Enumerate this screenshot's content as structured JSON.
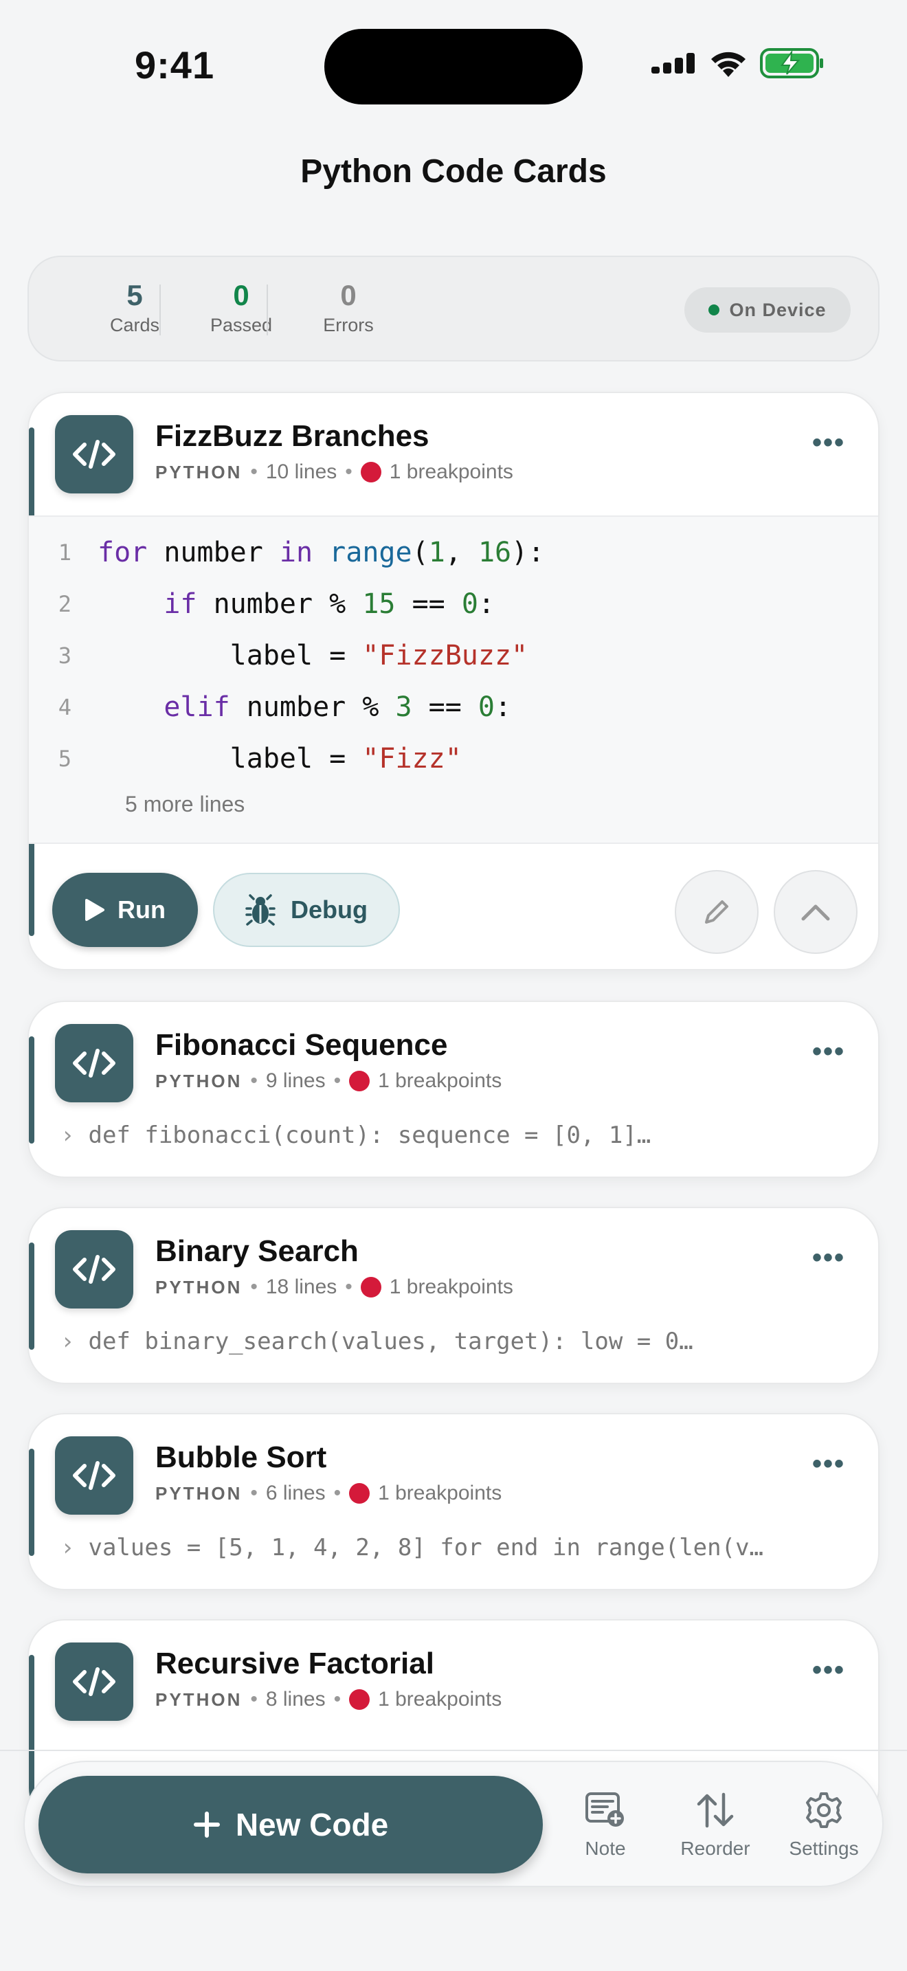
{
  "status_bar": {
    "time": "9:41"
  },
  "header": {
    "title": "Python Code Cards"
  },
  "stats": {
    "cards": {
      "value": "5",
      "label": "Cards"
    },
    "passed": {
      "value": "0",
      "label": "Passed"
    },
    "errors": {
      "value": "0",
      "label": "Errors"
    },
    "badge": "On Device"
  },
  "colors": {
    "accent": "#3e6168",
    "breakpoint": "#d41a3a",
    "passed": "#11854a"
  },
  "expanded_card": {
    "title": "FizzBuzz Branches",
    "lang": "PYTHON",
    "lines": "10 lines",
    "breakpoints": "1 breakpoints",
    "code": [
      {
        "n": "1",
        "tokens": [
          {
            "t": "for",
            "c": "kw"
          },
          {
            "t": " number ",
            "c": ""
          },
          {
            "t": "in",
            "c": "kw"
          },
          {
            "t": " ",
            "c": ""
          },
          {
            "t": "range",
            "c": "fn"
          },
          {
            "t": "(",
            "c": ""
          },
          {
            "t": "1",
            "c": "num"
          },
          {
            "t": ", ",
            "c": ""
          },
          {
            "t": "16",
            "c": "num"
          },
          {
            "t": "):",
            "c": ""
          }
        ]
      },
      {
        "n": "2",
        "tokens": [
          {
            "t": "    ",
            "c": ""
          },
          {
            "t": "if",
            "c": "kw"
          },
          {
            "t": " number % ",
            "c": ""
          },
          {
            "t": "15",
            "c": "num"
          },
          {
            "t": " == ",
            "c": ""
          },
          {
            "t": "0",
            "c": "num"
          },
          {
            "t": ":",
            "c": ""
          }
        ]
      },
      {
        "n": "3",
        "tokens": [
          {
            "t": "        label = ",
            "c": ""
          },
          {
            "t": "\"FizzBuzz\"",
            "c": "str"
          }
        ]
      },
      {
        "n": "4",
        "tokens": [
          {
            "t": "    ",
            "c": ""
          },
          {
            "t": "elif",
            "c": "kw"
          },
          {
            "t": " number % ",
            "c": ""
          },
          {
            "t": "3",
            "c": "num"
          },
          {
            "t": " == ",
            "c": ""
          },
          {
            "t": "0",
            "c": "num"
          },
          {
            "t": ":",
            "c": ""
          }
        ]
      },
      {
        "n": "5",
        "tokens": [
          {
            "t": "        label = ",
            "c": ""
          },
          {
            "t": "\"Fizz\"",
            "c": "str"
          }
        ]
      }
    ],
    "more_lines": "5 more lines",
    "run_label": "Run",
    "debug_label": "Debug"
  },
  "cards": [
    {
      "title": "Fibonacci Sequence",
      "lang": "PYTHON",
      "lines": "9 lines",
      "breakpoints": "1 breakpoints",
      "preview": "def fibonacci(count):     sequence = [0, 1]…"
    },
    {
      "title": "Binary Search",
      "lang": "PYTHON",
      "lines": "18 lines",
      "breakpoints": "1 breakpoints",
      "preview": "def binary_search(values, target):     low = 0…"
    },
    {
      "title": "Bubble Sort",
      "lang": "PYTHON",
      "lines": "6 lines",
      "breakpoints": "1 breakpoints",
      "preview": "values = [5, 1, 4, 2, 8] for end in range(len(v…"
    },
    {
      "title": "Recursive Factorial",
      "lang": "PYTHON",
      "lines": "8 lines",
      "breakpoints": "1 breakpoints",
      "preview": ""
    }
  ],
  "bottom_bar": {
    "new_code": "New Code",
    "note": "Note",
    "reorder": "Reorder",
    "settings": "Settings"
  }
}
